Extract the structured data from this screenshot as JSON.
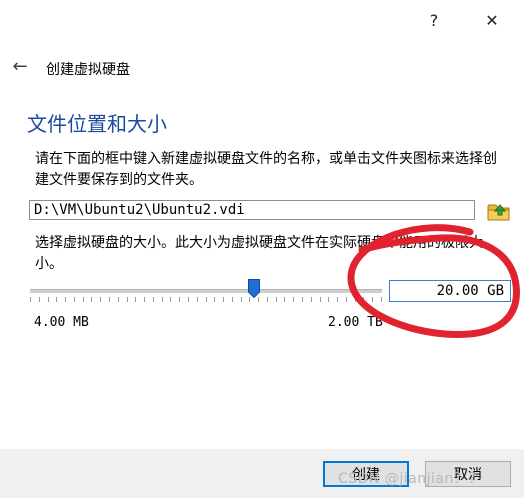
{
  "titlebar": {
    "help_label": "?",
    "close_label": "✕"
  },
  "wizard": {
    "back_icon": "←",
    "title": "创建虚拟硬盘"
  },
  "section": {
    "heading": "文件位置和大小"
  },
  "location": {
    "instruction": "请在下面的框中键入新建虚拟硬盘文件的名称，或单击文件夹图标来选择创建文件要保存到的文件夹。",
    "path_value": "D:\\VM\\Ubuntu2\\Ubuntu2.vdi",
    "folder_icon": "folder-icon"
  },
  "size": {
    "instruction": "选择虚拟硬盘的大小。此大小为虚拟硬盘文件在实际硬盘中能用的极限大小。",
    "value": "20.00 GB",
    "min_label": "4.00 MB",
    "max_label": "2.00 TB"
  },
  "buttons": {
    "create": "创建",
    "cancel": "取消"
  },
  "watermark": "CSDN @jianjian？？",
  "colors": {
    "heading": "#1b4aa0",
    "annotation": "#e0232e",
    "focus": "#0078d7"
  }
}
